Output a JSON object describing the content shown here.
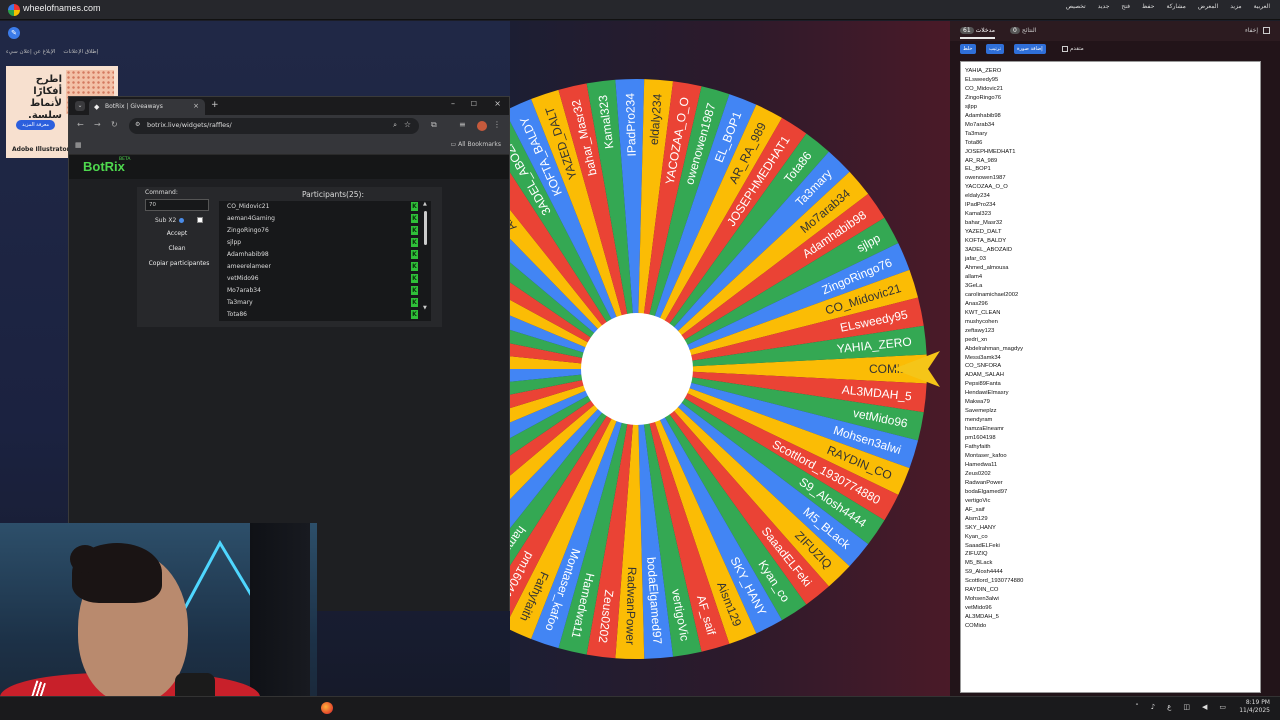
{
  "site": {
    "name": "wheelofnames.com"
  },
  "top_menu": [
    "العربية",
    "مزيد",
    "المعرض",
    "مشاركة",
    "حفظ",
    "فتح",
    "جديد",
    "تخصيص"
  ],
  "ad": {
    "report_label": "إطلاق الإعلانات",
    "report2_label": "الإبلاغ عن إعلان سيء",
    "headline": "اطرح أفكارًا لأنماط سلسة.",
    "cta": "معرفة المزيد",
    "brand": "Adobe Illustrator"
  },
  "browser": {
    "tab_title": "BotRix | Giveaways",
    "url": "botrix.live/widgets/raffles/",
    "bookmarks_label": "All Bookmarks"
  },
  "botrix": {
    "logo": "BotRix",
    "beta": "BETA",
    "command_label": "Command:",
    "command_value": "70",
    "sub_label": "Sub X2",
    "accept_label": "Accept",
    "clean_label": "Clean",
    "copy_label": "Copiar participantes",
    "participants_title": "Participants(25):",
    "participants": [
      "CO_Midovic21",
      "aeman4Gaming",
      "ZingoRingo76",
      "sjlpp",
      "Adamhabib98",
      "ameerelameer",
      "vetMido96",
      "Mo7arab34",
      "Ta3mary",
      "Tota86"
    ]
  },
  "wheel": {
    "colors": [
      "#fbbc05",
      "#ea4335",
      "#34a853",
      "#4285f4"
    ],
    "pointer_color": "#f5c518",
    "right_labels": [
      "COMido",
      "AL3MDAH_5",
      "vetMido96",
      "Mohsen3alwi",
      "RAYDIN_CO",
      "Scottlord_1930774",
      "S9_Alosh4444",
      "M5_BLack",
      "ZIFUZIQ",
      "SaaadELFeki",
      "Kyan_co",
      "SKY_HANY",
      "Aism129",
      "AF_saif",
      "vertigoVic",
      "bodaElgamed97",
      "RadwanPower",
      "Zeus0202",
      "Hamedwa11",
      "Montaser_kafoo",
      "Fathyfaith",
      "pm1604198",
      "hamzaElneamr",
      "mendyram"
    ],
    "top_labels": [
      "YAHIA_ZERO",
      "ELsweedy95",
      "CO_Midovic21",
      "ZingoRingo76",
      "sjlpp",
      "Adamhabib98",
      "Mo7arab34",
      "Ta3mary",
      "Tota86",
      "JOSEPHMEDHAT1",
      "AR_RA_989",
      "EL_BOP1",
      "owenowen1987",
      "YACOZAA_O_O",
      "eldaly234",
      "IPadPro234",
      "Kamal323",
      "bahar_Masr32",
      "YAZED_DALT",
      "KOFTA_BALDY",
      "3ADEL_ABOZAID",
      "jafar_03",
      "Ahmed_almousa",
      "allam4"
    ]
  },
  "right_panel": {
    "entries_tab": "مدخلات",
    "entries_count": "61",
    "results_tab": "النتائج",
    "results_count": "0",
    "hide_label": "إخفاء",
    "shuffle": "خلط",
    "sort": "ترتيب",
    "add_image": "إضافة صورة",
    "advanced": "متقدم",
    "entries": [
      "YAHIA_ZERO",
      "ELsweedy95",
      "CO_Midovic21",
      "ZingoRingo76",
      "sjlpp",
      "Adamhabib98",
      "Mo7arab34",
      "Ta3mary",
      "Tota86",
      "JOSEPHMEDHAT1",
      "AR_RA_989",
      "EL_BOP1",
      "owenowen1987",
      "YACOZAA_O_O",
      "eldaly234",
      "IPadPro234",
      "Kamal323",
      "bahar_Masr32",
      "YAZED_DALT",
      "KOFTA_BALDY",
      "3ADEL_ABOZAID",
      "jafar_03",
      "Ahmed_almousa",
      "allam4",
      "3GeLa",
      "carolinamichael2002",
      "Anas296",
      "KWT_CLEAN",
      "mushycohen",
      "zeftawy123",
      "pedri_xn",
      "Abdelrahman_magdyy",
      "Messi3amk34",
      "CO_SNFORA",
      "ADAM_SALAH",
      "Pepsi89Fanta",
      "HendawiElmasry",
      "Makwa79",
      "Savemeplzz",
      "mendyram",
      "hamzaElneamr",
      "pm1604198",
      "Fathyfaith",
      "Montaser_kafoo",
      "Hamedwa11",
      "Zeus0202",
      "RadwanPower",
      "bodaElgamed97",
      "vertigoVic",
      "AF_saif",
      "Aism129",
      "SKY_HANY",
      "Kyan_co",
      "SaaadELFeki",
      "ZIFUZIQ",
      "M5_BLack",
      "S9_Alosh4444",
      "Scottlord_1930774880",
      "RAYDIN_CO",
      "Mohsen3alwi",
      "vetMido96",
      "AL3MDAH_5",
      "COMido"
    ]
  },
  "taskbar": {
    "time": "8:19 PM",
    "date": "11/4/2025",
    "lang": "ع"
  }
}
